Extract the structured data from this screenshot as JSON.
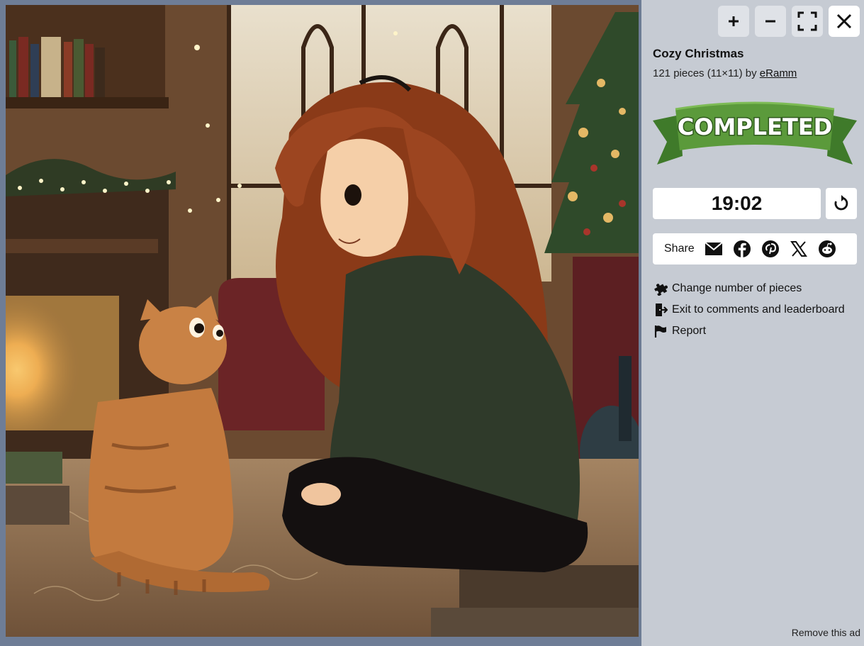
{
  "puzzle": {
    "title": "Cozy Christmas",
    "pieces_text": "121 pieces (11×11) by ",
    "author": "eRamm",
    "status_banner": "COMPLETED",
    "timer": "19:02"
  },
  "controls": {
    "zoom_in_icon": "plus-icon",
    "zoom_out_icon": "minus-icon",
    "fullscreen_icon": "fullscreen-icon",
    "close_icon": "close-icon",
    "restart_icon": "restart-icon"
  },
  "share": {
    "label": "Share",
    "items": [
      "email-icon",
      "facebook-icon",
      "pinterest-icon",
      "x-icon",
      "reddit-icon"
    ]
  },
  "links": [
    {
      "label": "Change number of pieces",
      "icon": "puzzle-piece-icon"
    },
    {
      "label": "Exit to comments and leaderboard",
      "icon": "exit-icon"
    },
    {
      "label": "Report",
      "icon": "flag-icon"
    }
  ],
  "footer": {
    "remove_ad": "Remove this ad"
  },
  "colors": {
    "panel_bg": "#c6cbd3",
    "puzzle_frame": "#6e7d96",
    "banner_green": "#5b9a3b"
  }
}
